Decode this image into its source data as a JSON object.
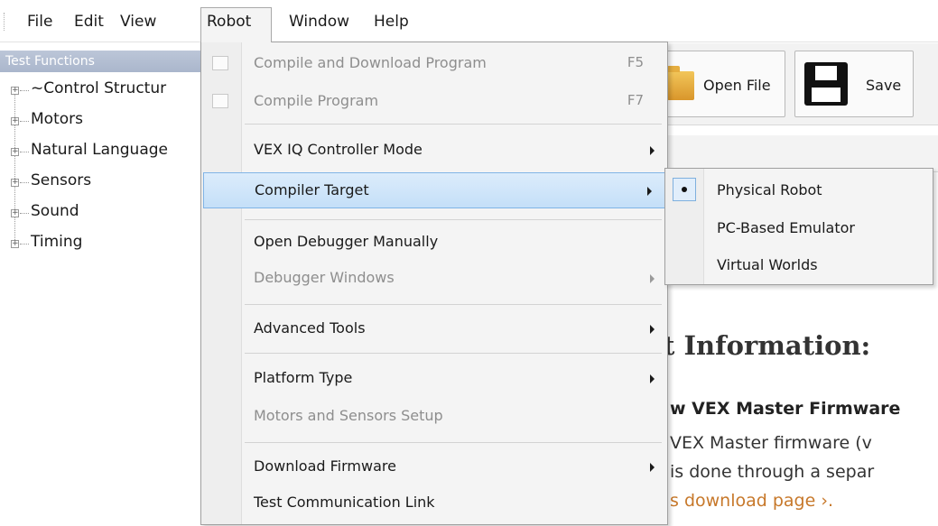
{
  "menubar": {
    "items": [
      "File",
      "Edit",
      "View",
      "Robot",
      "Window",
      "Help"
    ],
    "active": "Robot"
  },
  "tree": {
    "header": "Test Functions",
    "items": [
      "~Control Structur",
      "Motors",
      "Natural Language",
      "Sensors",
      "Sound",
      "Timing"
    ]
  },
  "toolbar": {
    "open_file": "Open File",
    "save": "Save"
  },
  "robot_menu": {
    "items": [
      {
        "label": "Compile and Download Program",
        "shortcut": "F5",
        "enabled": false
      },
      {
        "label": "Compile Program",
        "shortcut": "F7",
        "enabled": false
      },
      {
        "label": "VEX IQ Controller Mode",
        "submenu": true,
        "enabled": true
      },
      {
        "label": "Compiler Target",
        "submenu": true,
        "enabled": true,
        "highlighted": true
      },
      {
        "label": "Open Debugger Manually",
        "enabled": true
      },
      {
        "label": "Debugger Windows",
        "submenu": true,
        "enabled": false
      },
      {
        "label": "Advanced Tools",
        "submenu": true,
        "enabled": true
      },
      {
        "label": "Platform Type",
        "submenu": true,
        "enabled": true
      },
      {
        "label": "Motors and Sensors Setup",
        "enabled": false
      },
      {
        "label": "Download Firmware",
        "submenu": true,
        "enabled": true
      },
      {
        "label": "Test Communication Link",
        "enabled": true
      }
    ]
  },
  "compiler_target_submenu": {
    "items": [
      "Physical Robot",
      "PC-Based Emulator",
      "Virtual Worlds"
    ],
    "selected": "Physical Robot"
  },
  "content": {
    "heading": "t Information:",
    "subheading": "w VEX Master Firmware",
    "line1": "VEX Master firmware (v",
    "line2": "is done through a separ",
    "line3": "s download page ›."
  },
  "colors": {
    "highlight": "#c4dff8",
    "highlight_border": "#80b4e6",
    "disabled_text": "#8e8e8e",
    "link": "#c7782a"
  }
}
